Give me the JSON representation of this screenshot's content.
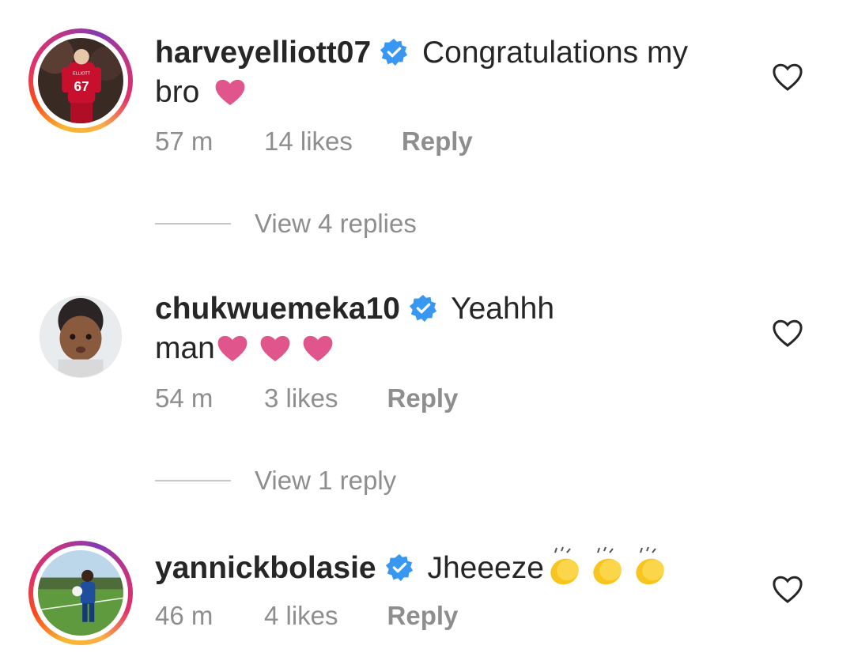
{
  "comments": [
    {
      "username": "harveyelliott07",
      "verified": true,
      "text": "Congratulations my bro",
      "emoji": "heart",
      "time": "57 m",
      "likes": "14 likes",
      "reply_label": "Reply",
      "view_replies": "View 4 replies",
      "avatar_jersey_number": "67",
      "avatar_jersey_name": "ELLIOTT"
    },
    {
      "username": "chukwuemeka10",
      "verified": true,
      "text_line1": "Yeahhh",
      "text_line2": "man",
      "emoji": "heart x3",
      "time": "54 m",
      "likes": "3 likes",
      "reply_label": "Reply",
      "view_replies": "View 1 reply"
    },
    {
      "username": "yannickbolasie",
      "verified": true,
      "text": "Jheeeze",
      "emoji": "clapping-hands x3",
      "time": "46 m",
      "likes": "4 likes",
      "reply_label": "Reply"
    }
  ],
  "colors": {
    "verified_blue": "#3897f0",
    "heart_pink": "#e0558b",
    "meta_gray": "#8e8e8e",
    "text_dark": "#262626"
  },
  "icons": {
    "like": "heart-outline-icon",
    "verified": "verified-badge-icon"
  }
}
